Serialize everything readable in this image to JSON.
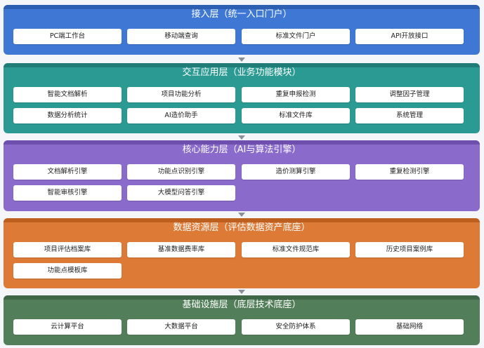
{
  "colors": {
    "layer1": "#3e78d4",
    "layer1_top": "#2c5eb1",
    "layer2": "#2b9a93",
    "layer2_top": "#1f7c76",
    "layer3": "#8a6acb",
    "layer3_top": "#6e4fae",
    "layer4": "#dd7a36",
    "layer4_top": "#bd5f1f",
    "layer5": "#527f59",
    "layer5_top": "#3f6646"
  },
  "layers": [
    {
      "title": "接入层（统一入口门户）",
      "items": [
        "PC端工作台",
        "移动端查询",
        "标准文件门户",
        "API开放接口"
      ]
    },
    {
      "title": "交互应用层（业务功能模块）",
      "items": [
        "智能文档解析",
        "项目功能分析",
        "重复申报检测",
        "调整因子管理",
        "数据分析统计",
        "AI造价助手",
        "标准文件库",
        "系统管理"
      ]
    },
    {
      "title": "核心能力层（AI与算法引擎）",
      "items": [
        "文档解析引擎",
        "功能点识别引擎",
        "造价测算引擎",
        "重复检测引擎",
        "智能审核引擎",
        "大模型问答引擎"
      ]
    },
    {
      "title": "数据资源层（评估数据资产底座）",
      "items": [
        "项目评估档案库",
        "基准数据费率库",
        "标准文件规范库",
        "历史项目案例库",
        "功能点模板库"
      ]
    },
    {
      "title": "基础设施层（底层技术底座）",
      "items": [
        "云计算平台",
        "大数据平台",
        "安全防护体系",
        "基础网络"
      ]
    }
  ]
}
